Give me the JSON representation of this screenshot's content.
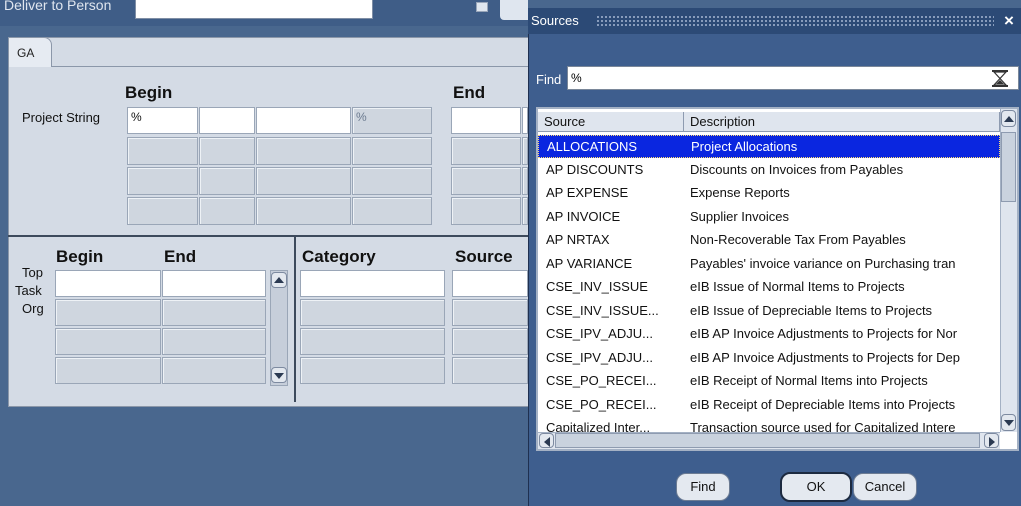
{
  "background_form": {
    "deliver_to_label": "Deliver to Person",
    "tab_label": "GA",
    "begin_header": "Begin",
    "end_header": "End",
    "project_string_label": "Project String",
    "project_string_first_value": "%",
    "project_string_percent": "%",
    "lower_begin_header": "Begin",
    "lower_end_header": "End",
    "category_header": "Category",
    "source_header": "Source",
    "row_labels": [
      "Top",
      "Task",
      "Org"
    ]
  },
  "dialog": {
    "title": "Sources",
    "close_label": "×",
    "find_label": "Find",
    "find_value": "%",
    "columns": [
      "Source",
      "Description"
    ],
    "rows": [
      {
        "source": "ALLOCATIONS",
        "description": "Project Allocations",
        "selected": true
      },
      {
        "source": "AP DISCOUNTS",
        "description": "Discounts on Invoices from Payables"
      },
      {
        "source": "AP EXPENSE",
        "description": "Expense Reports"
      },
      {
        "source": "AP INVOICE",
        "description": "Supplier Invoices"
      },
      {
        "source": "AP NRTAX",
        "description": "Non-Recoverable Tax From Payables"
      },
      {
        "source": "AP VARIANCE",
        "description": "Payables' invoice variance on Purchasing tran"
      },
      {
        "source": "CSE_INV_ISSUE",
        "description": "eIB Issue of Normal Items to Projects"
      },
      {
        "source": "CSE_INV_ISSUE...",
        "description": "eIB Issue of Depreciable Items to Projects"
      },
      {
        "source": "CSE_IPV_ADJU...",
        "description": "eIB AP Invoice Adjustments to Projects for Nor"
      },
      {
        "source": "CSE_IPV_ADJU...",
        "description": "eIB AP Invoice Adjustments to Projects for Dep"
      },
      {
        "source": "CSE_PO_RECEI...",
        "description": "eIB Receipt of Normal Items into Projects"
      },
      {
        "source": "CSE_PO_RECEI...",
        "description": "eIB Receipt of Depreciable Items into Projects"
      },
      {
        "source": "Capitalized Inter...",
        "description": "Transaction source used for Capitalized Intere"
      }
    ],
    "buttons": {
      "find": "Find",
      "ok": "OK",
      "cancel": "Cancel"
    }
  },
  "colors": {
    "selection": "#0a26e0",
    "dialog_bg": "#3e5e8e",
    "form_bg": "#d4dbe5"
  }
}
